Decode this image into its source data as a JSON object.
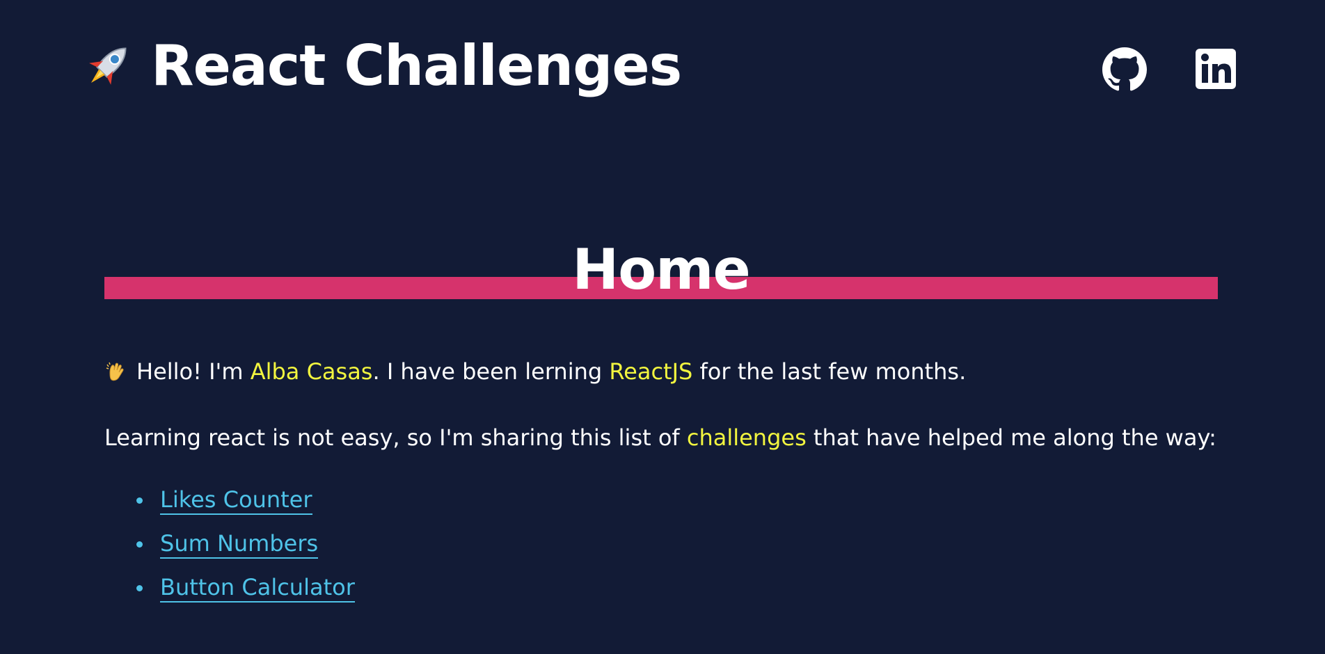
{
  "header": {
    "logo_icon": "rocket-icon",
    "title": "React Challenges",
    "social": [
      {
        "name": "github-icon"
      },
      {
        "name": "linkedin-icon"
      }
    ]
  },
  "main": {
    "section_title": "Home",
    "intro": {
      "wave_icon": "waving-hand-icon",
      "prefix": "Hello! I'm ",
      "name": "Alba Casas",
      "middle": ". I have been lerning ",
      "tech": "ReactJS",
      "suffix": " for the last few months."
    },
    "sharing": {
      "prefix": "Learning react is not easy, so I'm sharing this list of ",
      "highlight": "challenges",
      "suffix": " that have helped me along the way:"
    },
    "challenges": [
      {
        "label": "Likes Counter"
      },
      {
        "label": "Sum Numbers"
      },
      {
        "label": "Button Calculator"
      }
    ]
  },
  "colors": {
    "background": "#121b36",
    "accent_bar": "#d6336c",
    "highlight": "#f2f53f",
    "link": "#4fc3e8"
  }
}
